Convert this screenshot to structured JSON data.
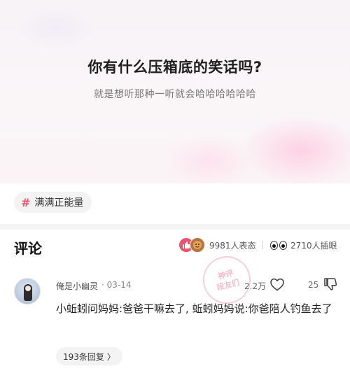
{
  "question": {
    "title": "你有什么压箱底的笑话吗?",
    "subtitle": "就是想听那种一听就会哈哈哈哈哈哈"
  },
  "topic": {
    "label": "满满正能量",
    "icon": "hash-icon"
  },
  "comments_header": {
    "title": "评论",
    "reactions_label": "9981人表态",
    "eyes_label": "2710人插眼"
  },
  "comment": {
    "username": "俺是小幽灵",
    "date": "· 03-14",
    "likes": "2.2万",
    "dislikes": "25",
    "text": "小蚯蚓问妈妈:爸爸干嘛去了, 蚯蚓妈妈说:你爸陪人钓鱼去了",
    "replies_label": "193条回复 〉"
  },
  "watermark": {
    "line1": "神评",
    "line2": "段友们"
  },
  "colors": {
    "accent": "#f0516d",
    "tag_bg": "#f3f3f3"
  }
}
